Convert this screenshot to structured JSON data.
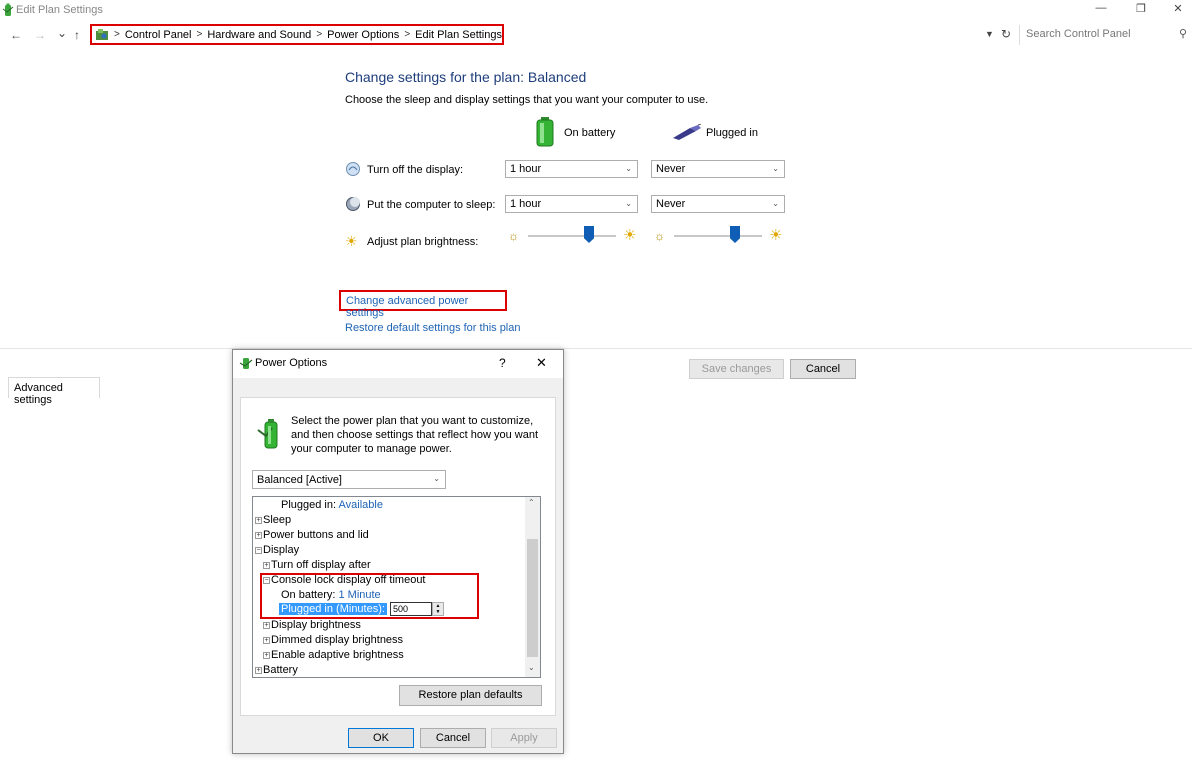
{
  "window": {
    "title": "Edit Plan Settings",
    "controls": {
      "minimize": "—",
      "restore": "❐",
      "close": "✕"
    }
  },
  "nav": {
    "back": "←",
    "forward": "→",
    "recent": "⌄",
    "up": "↑",
    "breadcrumbs": [
      "Control Panel",
      "Hardware and Sound",
      "Power Options",
      "Edit Plan Settings"
    ],
    "search_placeholder": "Search Control Panel"
  },
  "plan": {
    "title": "Change settings for the plan: Balanced",
    "description": "Choose the sleep and display settings that you want your computer to use.",
    "columns": {
      "battery": "On battery",
      "plugged": "Plugged in"
    },
    "rows": [
      {
        "label": "Turn off the display:",
        "on_battery": "1 hour",
        "plugged_in": "Never"
      },
      {
        "label": "Put the computer to sleep:",
        "on_battery": "1 hour",
        "plugged_in": "Never"
      }
    ],
    "brightness_label": "Adjust plan brightness:",
    "brightness_battery_fraction": 0.72,
    "brightness_plugged_fraction": 0.72,
    "advanced_link": "Change advanced power settings",
    "restore_link": "Restore default settings for this plan",
    "save_button": "Save changes",
    "cancel_button": "Cancel"
  },
  "dialog": {
    "title": "Power Options",
    "help": "?",
    "close": "✕",
    "tab": "Advanced settings",
    "description": "Select the power plan that you want to customize, and then choose settings that reflect how you want your computer to manage power.",
    "plan_select": "Balanced [Active]",
    "tree": {
      "plugged_in_prefix": "Plugged in:",
      "plugged_in_value": "Available",
      "sleep": "Sleep",
      "power_buttons": "Power buttons and lid",
      "display": "Display",
      "turn_off_display": "Turn off display after",
      "console_lock": "Console lock display off timeout",
      "on_battery_prefix": "On battery:",
      "on_battery_value": "1 Minute",
      "plugged_minutes_label": "Plugged in (Minutes):",
      "plugged_minutes_value": "500",
      "display_brightness": "Display brightness",
      "dimmed_brightness": "Dimmed display brightness",
      "adaptive_brightness": "Enable adaptive brightness",
      "battery": "Battery",
      "expand_glyph": "+",
      "collapse_glyph": "−"
    },
    "restore_button": "Restore plan defaults",
    "ok_button": "OK",
    "cancel_button": "Cancel",
    "apply_button": "Apply"
  }
}
